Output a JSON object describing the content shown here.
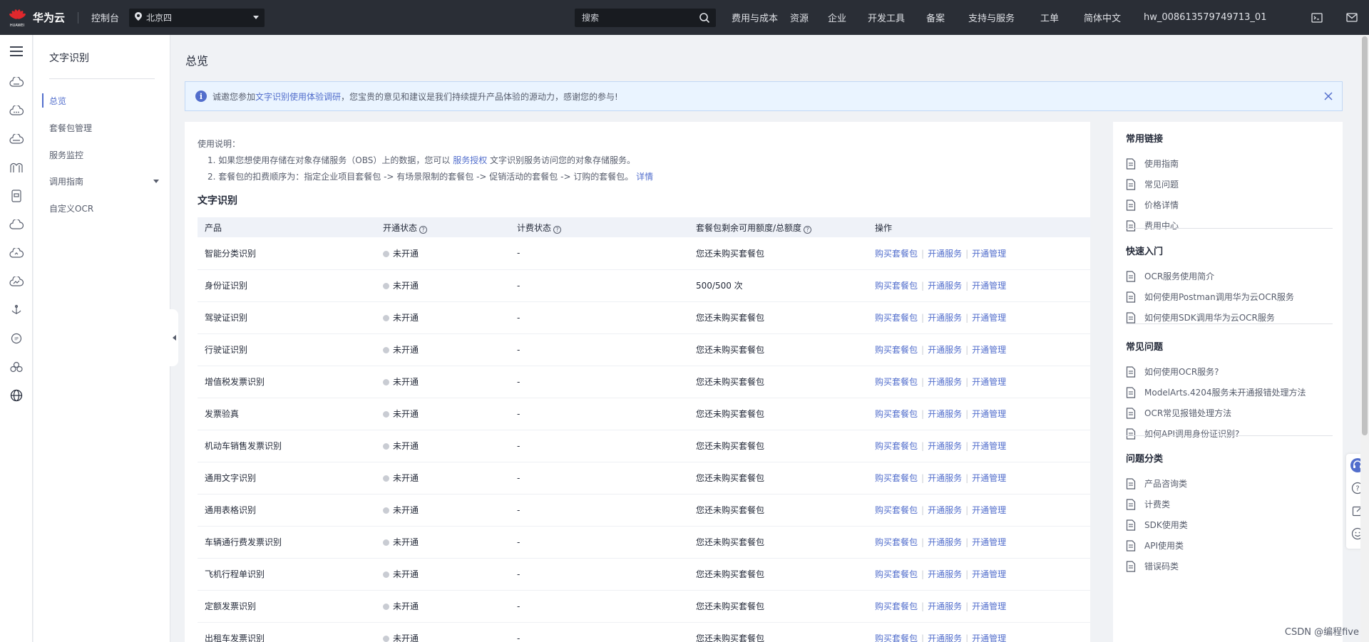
{
  "header": {
    "brand": "华为云",
    "logo_sub": "HUAWEI",
    "console": "控制台",
    "region": "北京四",
    "search_placeholder": "搜索",
    "nav": [
      "费用与成本",
      "资源",
      "企业",
      "开发工具",
      "备案",
      "支持与服务",
      "工单",
      "简体中文",
      "hw_008613579749713_01"
    ]
  },
  "submenu": {
    "title": "文字识别",
    "items": [
      "总览",
      "套餐包管理",
      "服务监控",
      "调用指南",
      "自定义OCR"
    ]
  },
  "page": {
    "title": "总览"
  },
  "notice": {
    "prefix": "诚邀您参加",
    "link": "文字识别使用体验调研",
    "suffix": "，您宝贵的意见和建议是我们持续提升产品体验的源动力，感谢您的参与!"
  },
  "usage": {
    "heading": "使用说明：",
    "line1_prefix": "1. 如果您想使用存储在对象存储服务（OBS）上的数据，您可以",
    "line1_link": "服务授权",
    "line1_suffix": "文字识别服务访问您的对象存储服务。",
    "line2_prefix": "2. 套餐包的扣费顺序为：指定企业项目套餐包 -> 有场景限制的套餐包 -> 促销活动的套餐包 -> 订购的套餐包。",
    "line2_link": "详情"
  },
  "section_title": "文字识别",
  "table": {
    "headers": [
      "产品",
      "开通状态",
      "计费状态",
      "套餐包剩余可用额度/总额度",
      "操作"
    ],
    "ops": [
      "购买套餐包",
      "开通服务",
      "开通管理"
    ],
    "rows": [
      {
        "product": "智能分类识别",
        "status": "未开通",
        "billing": "-",
        "quota": "您还未购买套餐包"
      },
      {
        "product": "身份证识别",
        "status": "未开通",
        "billing": "-",
        "quota": "500/500 次"
      },
      {
        "product": "驾驶证识别",
        "status": "未开通",
        "billing": "-",
        "quota": "您还未购买套餐包"
      },
      {
        "product": "行驶证识别",
        "status": "未开通",
        "billing": "-",
        "quota": "您还未购买套餐包"
      },
      {
        "product": "增值税发票识别",
        "status": "未开通",
        "billing": "-",
        "quota": "您还未购买套餐包"
      },
      {
        "product": "发票验真",
        "status": "未开通",
        "billing": "-",
        "quota": "您还未购买套餐包"
      },
      {
        "product": "机动车销售发票识别",
        "status": "未开通",
        "billing": "-",
        "quota": "您还未购买套餐包"
      },
      {
        "product": "通用文字识别",
        "status": "未开通",
        "billing": "-",
        "quota": "您还未购买套餐包"
      },
      {
        "product": "通用表格识别",
        "status": "未开通",
        "billing": "-",
        "quota": "您还未购买套餐包"
      },
      {
        "product": "车辆通行费发票识别",
        "status": "未开通",
        "billing": "-",
        "quota": "您还未购买套餐包"
      },
      {
        "product": "飞机行程单识别",
        "status": "未开通",
        "billing": "-",
        "quota": "您还未购买套餐包"
      },
      {
        "product": "定额发票识别",
        "status": "未开通",
        "billing": "-",
        "quota": "您还未购买套餐包"
      },
      {
        "product": "出租车发票识别",
        "status": "未开通",
        "billing": "-",
        "quota": "您还未购买套餐包"
      }
    ]
  },
  "right_panel": {
    "sections": [
      {
        "title": "常用链接",
        "links": [
          "使用指南",
          "常见问题",
          "价格详情",
          "费用中心"
        ]
      },
      {
        "title": "快速入门",
        "links": [
          "OCR服务使用简介",
          "如何使用Postman调用华为云OCR服务",
          "如何使用SDK调用华为云OCR服务"
        ]
      },
      {
        "title": "常见问题",
        "links": [
          "如何使用OCR服务?",
          "ModelArts.4204服务未开通报错处理方法",
          "OCR常见报错处理方法",
          "如何API调用身份证识别?"
        ]
      },
      {
        "title": "问题分类",
        "links": [
          "产品咨询类",
          "计费类",
          "SDK使用类",
          "API使用类",
          "错误码类"
        ]
      }
    ]
  },
  "watermark": "CSDN @编程five"
}
